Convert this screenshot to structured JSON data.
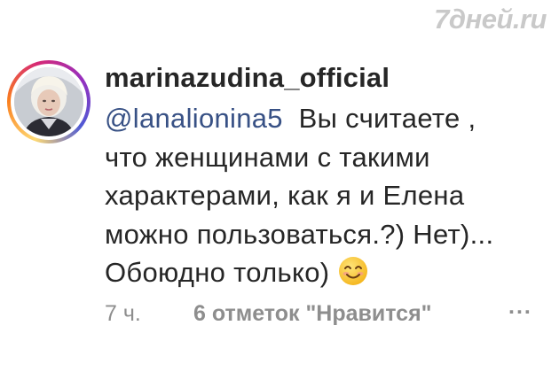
{
  "watermark": "7дней.ru",
  "post": {
    "username": "marinazudina_official",
    "mention": "@lanalionina5",
    "text_lines": [
      "Вы считаете ,",
      "что женщинами с такими",
      "характерами, как я и Елена",
      "можно пользоваться.?) Нет)...",
      "Обоюдно только)"
    ],
    "emoji": "smiling-face-emoji",
    "time": "7 ч.",
    "likes": "6 отметок \"Нравится\"",
    "more": "..."
  },
  "colors": {
    "mention": "#385185",
    "text": "#262626",
    "secondary": "#8e8e8e",
    "watermark": "#c9c9c9"
  }
}
